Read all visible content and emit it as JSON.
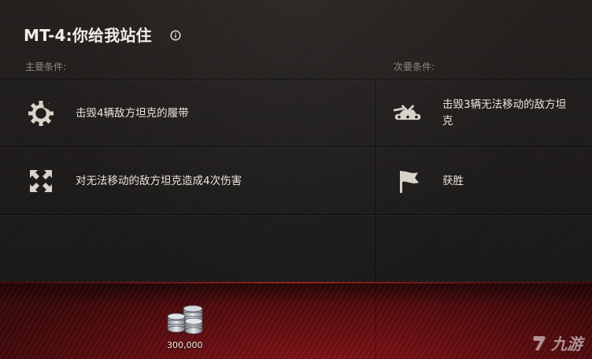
{
  "mission": {
    "title": "MT-4:你给我站住",
    "info_icon": "info-circle-icon"
  },
  "primary": {
    "header": "主要条件:",
    "conditions": [
      {
        "icon": "gear-track-icon",
        "text": "击毁4辆敌方坦克的履带"
      },
      {
        "icon": "immobilize-arrows-icon",
        "text": "对无法移动的敌方坦克造成4次伤害"
      }
    ]
  },
  "secondary": {
    "header": "次要条件:",
    "conditions": [
      {
        "icon": "tank-destroyed-icon",
        "text": "击毁3辆无法移动的敌方坦克"
      },
      {
        "icon": "victory-flag-icon",
        "text": "获胜"
      }
    ]
  },
  "reward": {
    "icon": "silver-coins-icon",
    "value": "300,000"
  },
  "watermark": {
    "text": "九游",
    "icon": "jiuyou-logo-icon"
  },
  "colors": {
    "reward_band": "#6a0f12",
    "panel_bg": "#1c1a19",
    "text": "#ebe6db",
    "label": "#8e8880"
  }
}
